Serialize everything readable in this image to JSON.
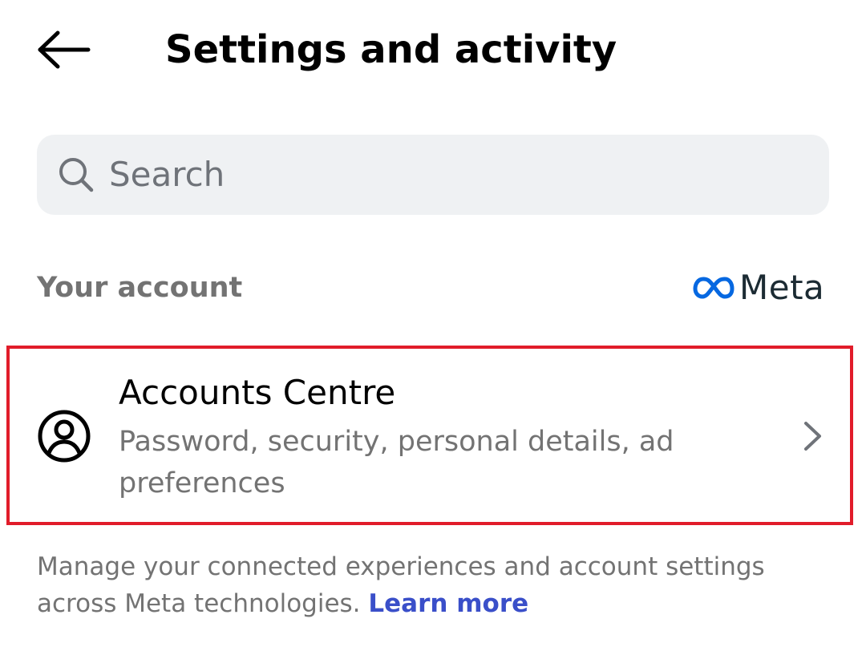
{
  "header": {
    "title": "Settings and activity",
    "back_icon": "arrow-left-icon"
  },
  "search": {
    "placeholder": "Search",
    "icon": "search-icon"
  },
  "section": {
    "label": "Your account",
    "brand": "Meta",
    "brand_colors": {
      "infinity": "#0668e1",
      "wordmark": "#1c2b33"
    }
  },
  "accounts_centre": {
    "title": "Accounts Centre",
    "subtitle": "Password, security, personal details, ad preferences",
    "icon": "user-circle-icon",
    "chevron": "chevron-right-icon",
    "highlight_color": "#e11c2a"
  },
  "footer": {
    "text": "Manage your connected experiences and account settings across Meta technologies.",
    "link": "Learn more",
    "link_color": "#3a4fc9"
  }
}
